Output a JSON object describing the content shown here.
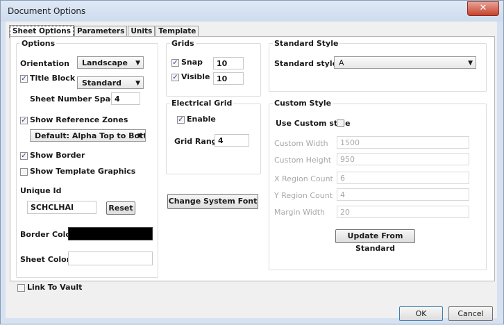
{
  "window": {
    "title": "Document Options",
    "close_glyph": "✕"
  },
  "tabs": [
    "Sheet Options",
    "Parameters",
    "Units",
    "Template"
  ],
  "options": {
    "title": "Options",
    "orientation_label": "Orientation",
    "orientation_value": "Landscape",
    "title_block_label": "Title Block",
    "title_block_checked": true,
    "title_block_value": "Standard",
    "sheet_number_spaces_label": "Sheet Number Spaces",
    "sheet_number_spaces_value": "4",
    "show_reference_zones_label": "Show Reference Zones",
    "show_reference_zones_checked": true,
    "reference_zone_value": "Default: Alpha Top to Botton",
    "show_border_label": "Show Border",
    "show_border_checked": true,
    "show_template_graphics_label": "Show Template Graphics",
    "show_template_graphics_checked": false,
    "unique_id_label": "Unique Id",
    "unique_id_value": "SCHCLHAI",
    "reset_label": "Reset",
    "border_color_label": "Border Color",
    "border_color": "#000000",
    "sheet_color_label": "Sheet Color",
    "sheet_color": "#ffffff"
  },
  "grids": {
    "title": "Grids",
    "snap_label": "Snap",
    "snap_checked": true,
    "snap_value": "10",
    "visible_label": "Visible",
    "visible_checked": true,
    "visible_value": "10"
  },
  "electrical_grid": {
    "title": "Electrical Grid",
    "enable_label": "Enable",
    "enable_checked": true,
    "grid_range_label": "Grid Range",
    "grid_range_value": "4"
  },
  "change_font_label": "Change System Font",
  "standard_style": {
    "title": "Standard Style",
    "label": "Standard styles",
    "value": "A"
  },
  "custom_style": {
    "title": "Custom Style",
    "use_label": "Use Custom style",
    "use_checked": false,
    "width_label": "Custom Width",
    "width_value": "1500",
    "height_label": "Custom Height",
    "height_value": "950",
    "x_region_label": "X Region Count",
    "x_region_value": "6",
    "y_region_label": "Y Region Count",
    "y_region_value": "4",
    "margin_label": "Margin Width",
    "margin_value": "20",
    "update_label": "Update From Standard"
  },
  "link_to_vault_label": "Link To Vault",
  "link_to_vault_checked": false,
  "ok_label": "OK",
  "cancel_label": "Cancel",
  "check_glyph": "✓",
  "dropdown_glyph": "▼"
}
